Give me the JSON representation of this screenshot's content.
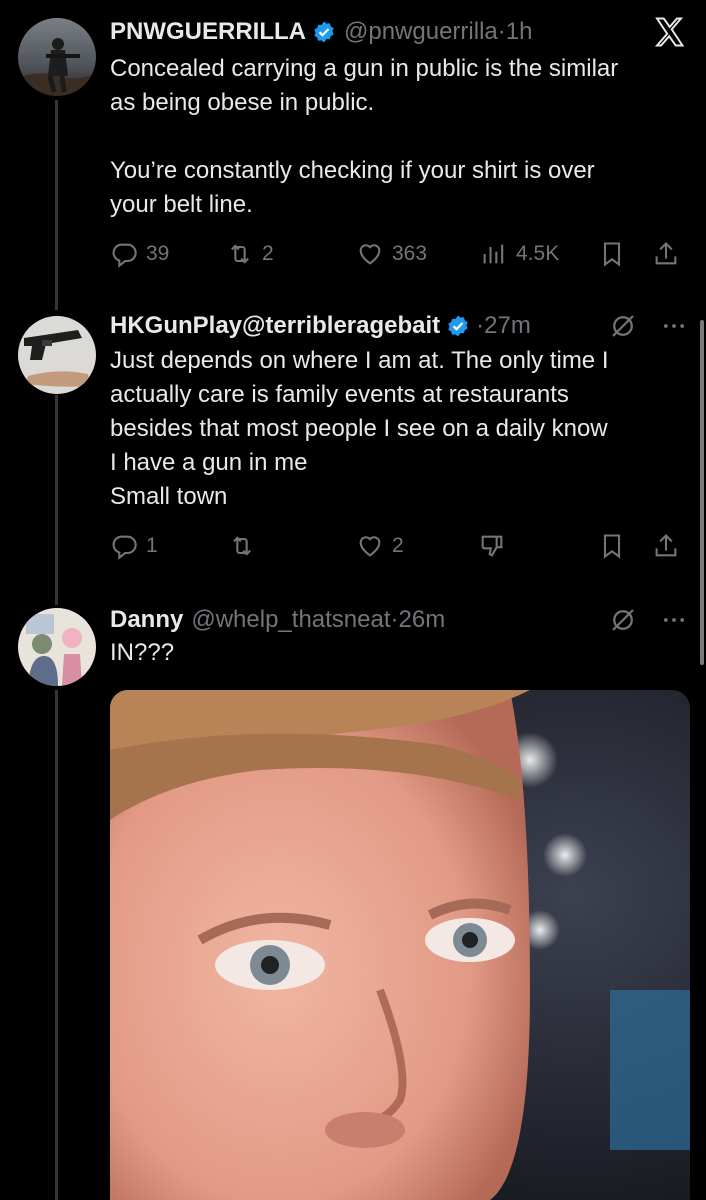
{
  "tweets": [
    {
      "name": "PNWGUERRILLA",
      "handle": "@pnwguerrilla",
      "dot": "·",
      "time": "1h",
      "verified": true,
      "text": "Concealed carrying a gun in public is the similar\nas being obese in public.\n\nYou’re constantly checking if your shirt is over\nyour belt line.",
      "replies": "39",
      "reposts": "2",
      "likes": "363",
      "views": "4.5K"
    },
    {
      "name": "HKGunPlay",
      "handle": "@terribleragebait",
      "dot": "·",
      "time": "27m",
      "verified": true,
      "text": "Just depends on where I am at. The only time I\nactually care is family events at restaurants\nbesides that most people I see on a daily know\nI have a gun in me\nSmall town",
      "replies": "1",
      "reposts": "",
      "likes": "2"
    },
    {
      "name": "Danny",
      "handle": "@whelp_thatsneat",
      "dot": "·",
      "time": "26m",
      "verified": false,
      "text": "IN???"
    }
  ],
  "icons": {
    "app_logo": "x-logo-icon",
    "reply": "reply-icon",
    "repost": "repost-icon",
    "like": "heart-icon",
    "views": "views-icon",
    "bookmark": "bookmark-icon",
    "share": "share-icon",
    "grok": "grok-icon",
    "more": "more-icon",
    "dislike": "dislike-icon"
  },
  "colors": {
    "background": "#000000",
    "text": "#e7e9ea",
    "muted": "#71767b",
    "verified": "#1d9bf0",
    "thread_line": "#333639"
  }
}
